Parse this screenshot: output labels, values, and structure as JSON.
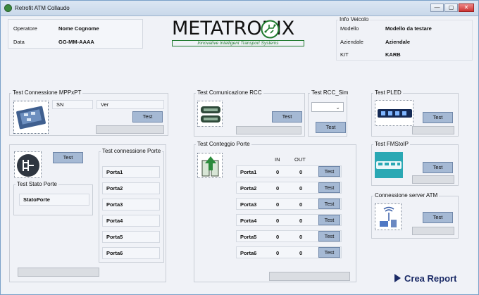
{
  "window": {
    "title": "Retrofit ATM Collaudo",
    "controls": [
      "—",
      "▢",
      "✕"
    ]
  },
  "header": {
    "operator_label": "Operatore",
    "operator_value": "Nome Cognome",
    "date_label": "Data",
    "date_value": "GG-MM-AAAA",
    "logo_name": "METATRONIX",
    "logo_tagline": "Innovative Intelligent Transport Systems"
  },
  "vehicle": {
    "legend": "Info Veicolo",
    "model_label": "Modello",
    "model_value": "Modello da testare",
    "company_label": "Aziendale",
    "company_value": "Aziendale",
    "kit_label": "KIT",
    "kit_value": "KARB"
  },
  "mppxpt": {
    "legend": "Test Connessione MPPxPT",
    "sn_label": "SN",
    "ver_label": "Ver",
    "test_label": "Test"
  },
  "ports_conn": {
    "legend": "Test connessione Porte",
    "test_label": "Test",
    "ports": [
      "Porta1",
      "Porta2",
      "Porta3",
      "Porta4",
      "Porta5",
      "Porta6"
    ]
  },
  "stato_porte": {
    "legend": "Test Stato Porte",
    "value": "StatoPorte"
  },
  "rcc": {
    "legend": "Test Comunicazione RCC",
    "test_label": "Test"
  },
  "rcc_sim": {
    "legend": "Test RCC_Sim",
    "test_label": "Test",
    "selected": ""
  },
  "counting": {
    "legend": "Test Conteggio Porte",
    "in_header": "IN",
    "out_header": "OUT",
    "test_label": "Test",
    "rows": [
      {
        "name": "Porta1",
        "in": "0",
        "out": "0"
      },
      {
        "name": "Porta2",
        "in": "0",
        "out": "0"
      },
      {
        "name": "Porta3",
        "in": "0",
        "out": "0"
      },
      {
        "name": "Porta4",
        "in": "0",
        "out": "0"
      },
      {
        "name": "Porta5",
        "in": "0",
        "out": "0"
      },
      {
        "name": "Porta6",
        "in": "0",
        "out": "0"
      }
    ]
  },
  "pled": {
    "legend": "Test PLED",
    "test_label": "Test"
  },
  "fmstoip": {
    "legend": "Test FMStoIP",
    "test_label": "Test"
  },
  "server": {
    "legend": "Connessione server ATM",
    "test_label": "Test"
  },
  "report": {
    "label": "Crea Report"
  },
  "colors": {
    "button": "#a5b9d4",
    "accent": "#1a2a66",
    "logo_green": "#1f7a2e"
  }
}
